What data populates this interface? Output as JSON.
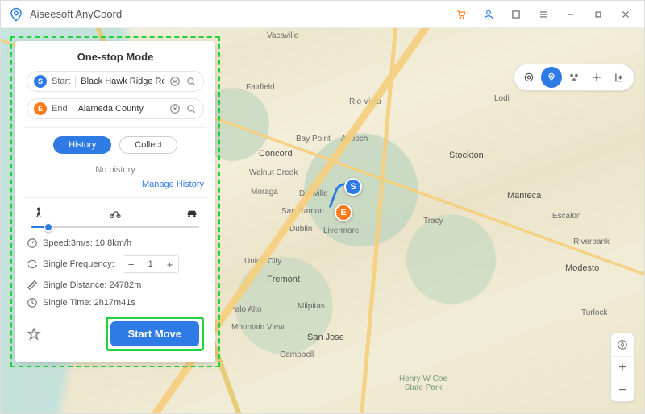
{
  "app": {
    "title": "Aiseesoft AnyCoord"
  },
  "panel": {
    "title": "One-stop Mode",
    "start_label": "Start",
    "start_value": "Black Hawk Ridge Roa",
    "end_label": "End",
    "end_value": "Alameda County",
    "history_tab": "History",
    "collect_tab": "Collect",
    "no_history": "No history",
    "manage_history": "Manage History",
    "speed_label": "Speed:3m/s; 10.8km/h",
    "freq_label": "Single Frequency:",
    "freq_value": "1",
    "distance_label": "Single Distance: 24782m",
    "time_label": "Single Time: 2h17m41s",
    "start_move": "Start Move"
  },
  "map_labels": {
    "vacaville": "Vacaville",
    "fairfield": "Fairfield",
    "rio_vista": "Rio Vista",
    "lodi": "Lodi",
    "bay_point": "Bay Point",
    "antioch": "Antioch",
    "concord": "Concord",
    "stockton": "Stockton",
    "walnut_creek": "Walnut Creek",
    "moraga": "Moraga",
    "danville": "Danville",
    "manteca": "Manteca",
    "san_ramon": "San Ramon",
    "tracy": "Tracy",
    "dublin": "Dublin",
    "livermore": "Livermore",
    "escalon": "Escalon",
    "riverbank": "Riverbank",
    "union_city": "Union City",
    "fremont": "Fremont",
    "modesto": "Modesto",
    "palo_alto": "Palo Alto",
    "milpitas": "Milpitas",
    "turlock": "Turlock",
    "mountain_view": "Mountain View",
    "san_jose": "San Jose",
    "campbell": "Campbell",
    "henry_coe": "Henry W Coe\nState Park"
  },
  "route": {
    "start_letter": "S",
    "end_letter": "E"
  }
}
